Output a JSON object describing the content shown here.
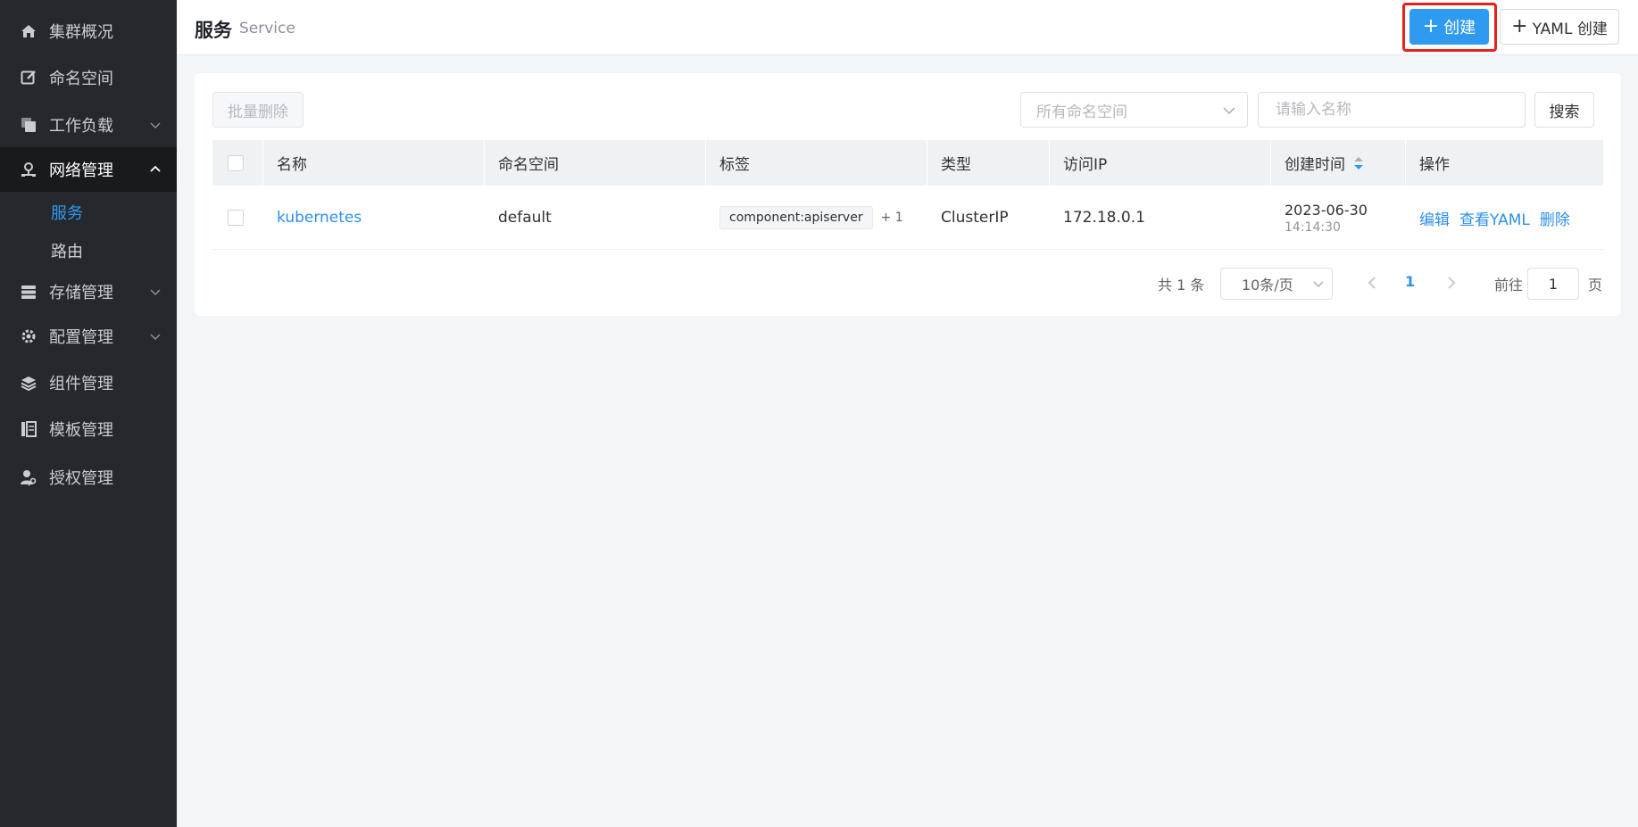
{
  "sidebar": {
    "items": [
      {
        "label": "集群概况",
        "icon": "home-icon"
      },
      {
        "label": "命名空间",
        "icon": "edit-square-icon"
      },
      {
        "label": "工作负载",
        "icon": "copy-icon"
      },
      {
        "label": "网络管理",
        "icon": "network-icon"
      },
      {
        "label": "存储管理",
        "icon": "storage-icon"
      },
      {
        "label": "配置管理",
        "icon": "gear-icon"
      },
      {
        "label": "组件管理",
        "icon": "layers-icon"
      },
      {
        "label": "模板管理",
        "icon": "template-icon"
      },
      {
        "label": "授权管理",
        "icon": "user-key-icon"
      }
    ],
    "network_sub": [
      {
        "label": "服务"
      },
      {
        "label": "路由"
      }
    ],
    "colors": {
      "bg": "#26282d",
      "active_bg": "#191a1e",
      "accent": "#2e9bf0"
    }
  },
  "header": {
    "title": "服务",
    "subtitle": "Service",
    "create_label": "创建",
    "yaml_create_label": "YAML 创建"
  },
  "toolbar": {
    "batch_delete_label": "批量删除",
    "namespace_placeholder": "所有命名空间",
    "name_placeholder": "请输入名称",
    "search_label": "搜索"
  },
  "table": {
    "columns": [
      "名称",
      "命名空间",
      "标签",
      "类型",
      "访问IP",
      "创建时间",
      "操作"
    ],
    "rows": [
      {
        "name": "kubernetes",
        "namespace": "default",
        "tag": "component:apiserver",
        "tag_more": "+ 1",
        "type": "ClusterIP",
        "ip": "172.18.0.1",
        "date": "2023-06-30",
        "time": "14:14:30",
        "actions": [
          "编辑",
          "查看YAML",
          "删除"
        ]
      }
    ]
  },
  "pagination": {
    "total_text": "共 1 条",
    "page_size": "10条/页",
    "current_page": "1",
    "goto_label": "前往",
    "goto_value": "1",
    "goto_suffix": "页"
  },
  "colors": {
    "primary": "#2e9bf0",
    "highlight": "#e8201b",
    "link": "#2e8fe8"
  }
}
